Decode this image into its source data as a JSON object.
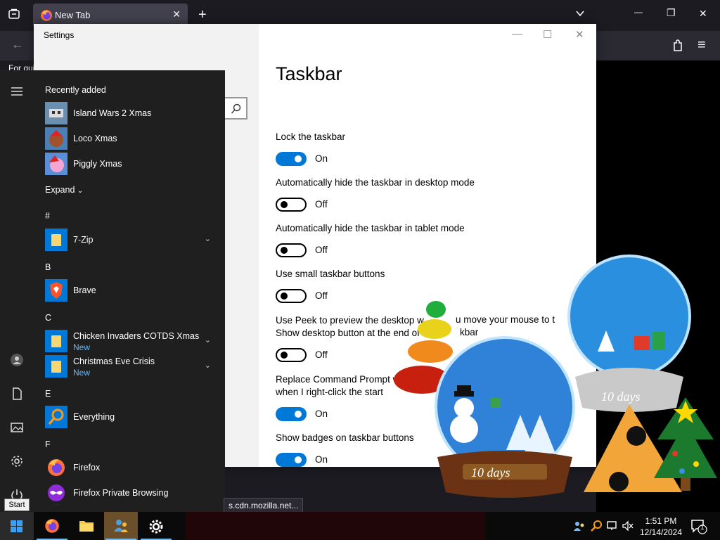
{
  "browser": {
    "tab_title": "New Tab",
    "tab_close": "✕",
    "new_tab": "+",
    "list_tabs": "⌄",
    "minimize": "—",
    "restore": "❐",
    "close": "✕",
    "toolbar_back": "←",
    "menu_glyph": "≡",
    "status_url": "s.cdn.mozilla.net...",
    "partial_text": "For qui..."
  },
  "settings": {
    "window_title": "Settings",
    "page_title": "Taskbar",
    "minimize": "—",
    "maximize": "☐",
    "close": "✕",
    "options": [
      {
        "label": "Lock the taskbar",
        "label2": "",
        "state": "On",
        "on": true
      },
      {
        "label": "Automatically hide the taskbar in desktop mode",
        "label2": "",
        "state": "Off",
        "on": false
      },
      {
        "label": "Automatically hide the taskbar in tablet mode",
        "label2": "",
        "state": "Off",
        "on": false
      },
      {
        "label": "Use small taskbar buttons",
        "label2": "",
        "state": "Off",
        "on": false
      },
      {
        "label": "Use Peek to preview the desktop w",
        "label2": "Show desktop button at the end of",
        "state": "Off",
        "on": false
      },
      {
        "label": "Replace Command Prompt w",
        "label2": "when I right-click the start",
        "state": "On",
        "on": true
      },
      {
        "label": "Show badges on taskbar buttons",
        "label2": "",
        "state": "On",
        "on": true
      }
    ],
    "overlap_frag_1": "u move your mouse to t",
    "overlap_frag_2": "kbar"
  },
  "start_menu": {
    "recently_added": "Recently added",
    "recent": [
      {
        "name": "Island Wars 2 Xmas"
      },
      {
        "name": "Loco Xmas"
      },
      {
        "name": "Piggly Xmas"
      }
    ],
    "expand": "Expand",
    "groups": {
      "hash": "#",
      "b": "B",
      "c": "C",
      "e": "E",
      "f": "F"
    },
    "apps": {
      "zip": "7-Zip",
      "brave": "Brave",
      "chicken": "Chicken Invaders COTDS Xmas",
      "chicken_sub": "New",
      "christmas": "Christmas Eve Crisis",
      "christmas_sub": "New",
      "everything": "Everything",
      "firefox": "Firefox",
      "firefox_private": "Firefox Private Browsing"
    },
    "tooltip": "Start"
  },
  "desktop": {
    "countdown_1": "10 days",
    "countdown_2": "10 days"
  },
  "taskbar": {
    "time": "1:51 PM",
    "date": "12/14/2024",
    "notification_count": "1"
  }
}
